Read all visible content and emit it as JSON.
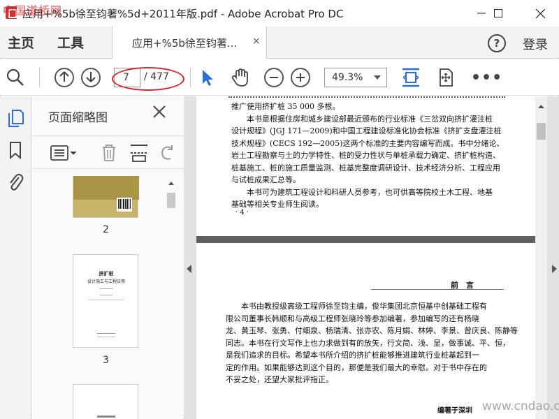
{
  "window": {
    "title": "应用+%5b徐至钧著%5d+2011年版.pdf - Adobe Acrobat Pro DC",
    "watermark": "中国道桥网"
  },
  "tabs": {
    "home": "主页",
    "tools": "工具",
    "doc_tab": "应用+%5b徐至钧著...",
    "doc_tab_close": "×",
    "help": "?",
    "login": "登录"
  },
  "toolbar": {
    "page_current": "7",
    "page_total": "/ 477",
    "zoom": "49.3%",
    "more": "•••"
  },
  "panel": {
    "title": "页面缩略图",
    "thumbnails": [
      {
        "num": "2"
      },
      {
        "num": "3",
        "title": "挤扩桩",
        "subtitle": "设计施工与工程应用"
      }
    ]
  },
  "page_a": {
    "lines": [
      "推广使用挤扩桩 35 000 多根。",
      "　　本书是根据住房和城乡建设部最近颁布的行业标准《三岔双向挤扩灌注桩",
      "设计规程》(JGJ 171—2009)和中国工程建设标准化协会标准《挤扩支盘灌注桩",
      "技术规程》(CECS 192—2005)这两个标准的主要内容编写而成。书中分绪论、",
      "岩土工程勘察与土的力学特性、桩的受力性状与单桩承载力确定、挤扩桩构造、",
      "桩基施工、桩的施工质量监测、桩基完整度调研设计、技术经济分析、工程应用",
      "与试桩成果汇总等。",
      "　　本书可为建筑工程设计和科研人员参考，也可供高等院校土木工程、地基",
      "基础等相关专业师生阅读。"
    ],
    "page_no": "· 4 ·"
  },
  "page_b": {
    "heading": "前　言",
    "lines": [
      "　　本书由教授级高级工程师徐至钧主编，俊华集团北京恒基中创基础工程有",
      "限公司董事长韩顺和与高级工程师张晓玲等参加编著，参加编写的还有杨晓",
      "龙、黄玉琴、张勇、付细泉、杨瑞清、张亦农、陈月娟、林婷、李景、曾庆良、陈静等",
      "同志。本书在行文写作上也力求做到有的放矢，行文简、浅、显，做事诚、平、恒，",
      "是我们追求的目标。希望本书所介绍的挤扩桩能够推进建筑行业桩基起到一",
      "定的作用。如果能够达到这个目的，那便是我们最大的幸慰。对于书中存在的",
      "不妥之处，还望大家批评指正。"
    ],
    "signature": "编著于深圳"
  },
  "site_watermark": "www.cndao.com",
  "colors": {
    "accent": "#2c6fd1",
    "annotation": "#d8232a",
    "cover": "#c9b56a"
  }
}
